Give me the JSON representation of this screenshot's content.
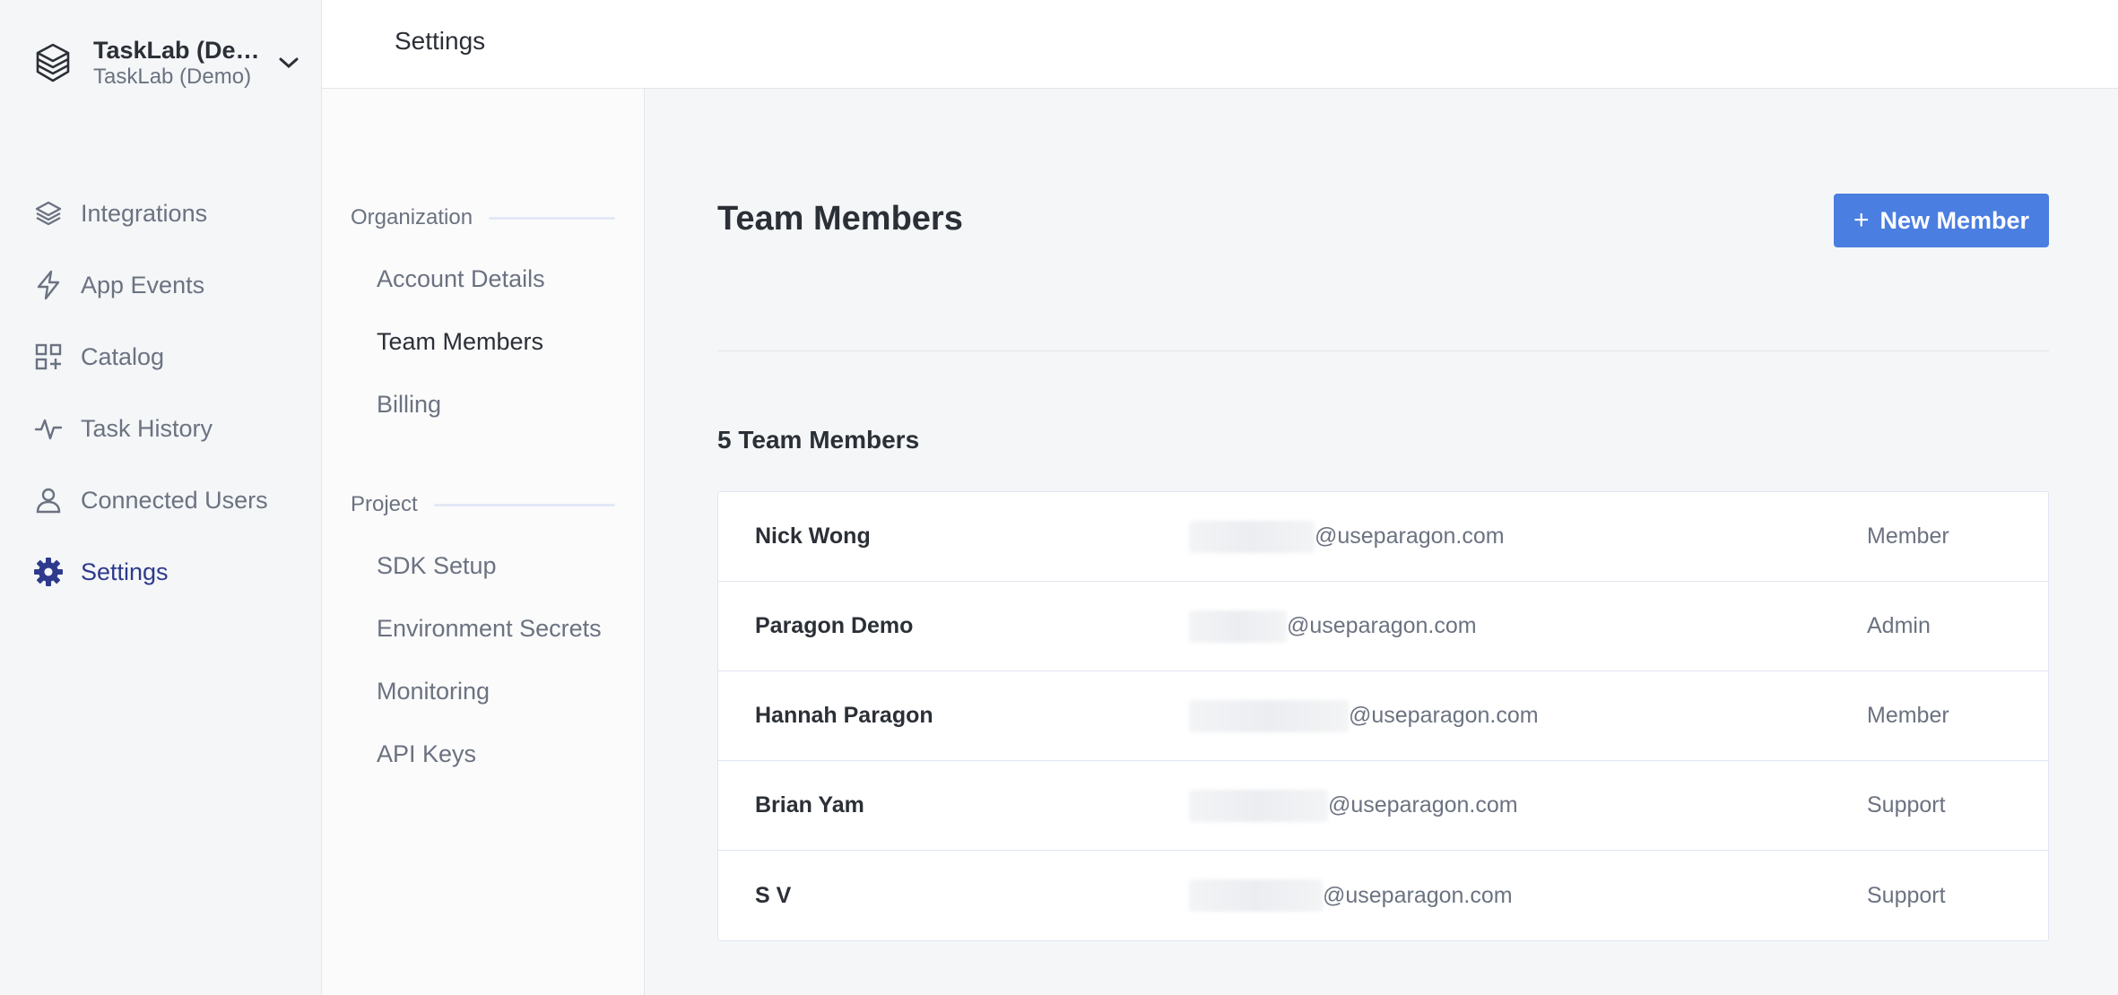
{
  "workspace": {
    "name": "TaskLab (Demo)",
    "subtitle": "TaskLab (Demo)",
    "icon": "layers-icon"
  },
  "sidebar": {
    "items": [
      {
        "label": "Integrations",
        "icon": "layers-icon",
        "active": false
      },
      {
        "label": "App Events",
        "icon": "lightning-icon",
        "active": false
      },
      {
        "label": "Catalog",
        "icon": "grid-plus-icon",
        "active": false
      },
      {
        "label": "Task History",
        "icon": "activity-icon",
        "active": false
      },
      {
        "label": "Connected Users",
        "icon": "user-icon",
        "active": false
      },
      {
        "label": "Settings",
        "icon": "gear-icon",
        "active": true
      }
    ]
  },
  "header": {
    "title": "Settings"
  },
  "subnav": {
    "organization_label": "Organization",
    "organization_items": [
      "Account Details",
      "Team Members",
      "Billing"
    ],
    "project_label": "Project",
    "project_items": [
      "SDK Setup",
      "Environment Secrets",
      "Monitoring",
      "API Keys"
    ],
    "active": "Team Members"
  },
  "main": {
    "title": "Team Members",
    "new_member_label": "New Member",
    "count_label": "5 Team Members",
    "members": [
      {
        "name": "Nick Wong",
        "email_domain": "@useparagon.com",
        "role": "Member"
      },
      {
        "name": "Paragon Demo",
        "email_domain": "@useparagon.com",
        "role": "Admin"
      },
      {
        "name": "Hannah Paragon",
        "email_domain": "@useparagon.com",
        "role": "Member"
      },
      {
        "name": "Brian Yam",
        "email_domain": "@useparagon.com",
        "role": "Support"
      },
      {
        "name": "S V",
        "email_domain": "@useparagon.com",
        "role": "Support"
      }
    ]
  },
  "colors": {
    "accent": "#4a7ee0",
    "active_nav": "#2e3a8c",
    "muted_text": "#6b7280",
    "dark_text": "#2b2f36"
  }
}
